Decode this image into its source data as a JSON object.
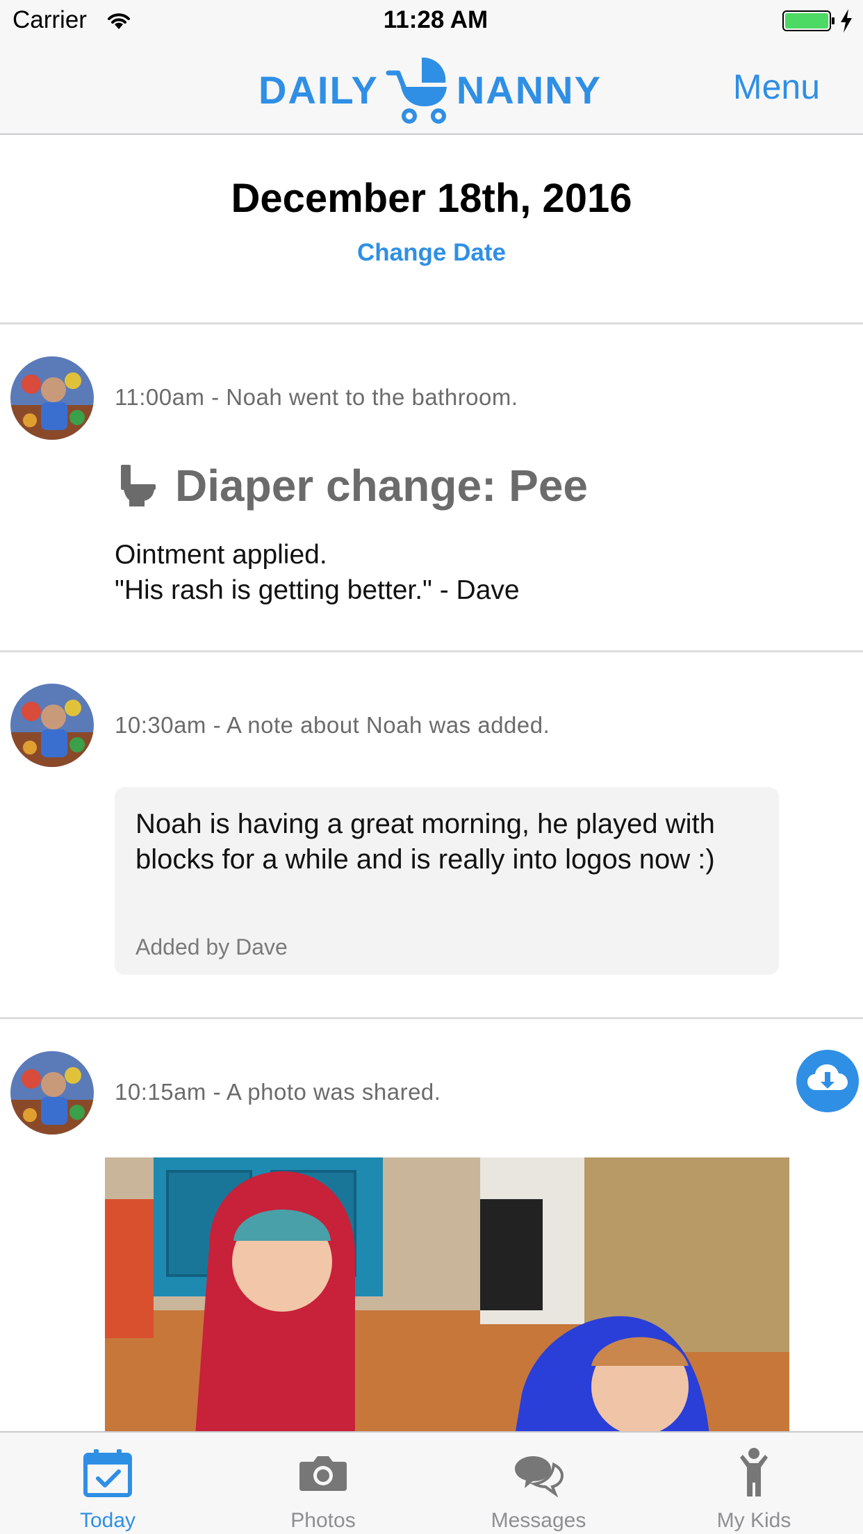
{
  "status_bar": {
    "carrier": "Carrier",
    "time": "11:28 AM",
    "battery_color": "#4cd964"
  },
  "nav": {
    "logo_left": "DAILY",
    "logo_right": "NANNY",
    "menu_label": "Menu",
    "accent_color": "#2f8fe5"
  },
  "date_header": {
    "date": "December 18th, 2016",
    "change_date_label": "Change Date"
  },
  "feed": [
    {
      "meta": "11:00am - Noah went to the bathroom.",
      "icon": "toilet-icon",
      "title": "Diaper change: Pee",
      "lines": [
        "Ointment applied.",
        "\"His rash is getting better.\" - Dave"
      ]
    },
    {
      "meta": "10:30am - A note about Noah was added.",
      "note": "Noah is having a great morning, he played with blocks for a while and is really into logos now :)",
      "author": "Added by Dave"
    },
    {
      "meta": "10:15am - A photo was shared.",
      "action_icon": "cloud-download-icon"
    }
  ],
  "tabs": [
    {
      "label": "Today",
      "icon": "calendar-check-icon",
      "active": true
    },
    {
      "label": "Photos",
      "icon": "camera-icon",
      "active": false
    },
    {
      "label": "Messages",
      "icon": "chat-bubbles-icon",
      "active": false
    },
    {
      "label": "My Kids",
      "icon": "child-icon",
      "active": false
    }
  ]
}
